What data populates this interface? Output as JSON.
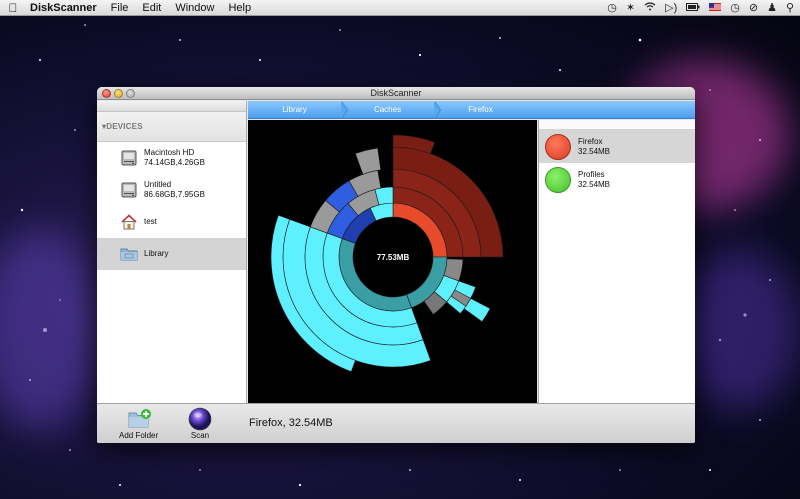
{
  "menubar": {
    "apple_icon": "apple-icon",
    "app_name": "DiskScanner",
    "items": [
      "File",
      "Edit",
      "Window",
      "Help"
    ],
    "status_icons": [
      "time-machine-icon",
      "bluetooth-icon",
      "wifi-icon",
      "volume-icon",
      "battery-icon",
      "flag-icon",
      "clock-icon",
      "no-entry-icon",
      "user-icon",
      "spotlight-icon"
    ]
  },
  "window": {
    "title": "DiskScanner"
  },
  "sidebar": {
    "header": "▾DEVICES",
    "items": [
      {
        "name": "Macintosh HD",
        "detail": "74.14GB,4.26GB",
        "icon": "hard-drive-icon",
        "selected": false
      },
      {
        "name": "Untitled",
        "detail": "86.68GB,7.95GB",
        "icon": "hard-drive-icon",
        "selected": false
      },
      {
        "name": "test",
        "detail": "",
        "icon": "home-icon",
        "selected": false
      },
      {
        "name": "Library",
        "detail": "",
        "icon": "folder-icon",
        "selected": true
      }
    ]
  },
  "breadcrumb": [
    "Library",
    "Caches",
    "Firefox"
  ],
  "chart_data": {
    "type": "sunburst",
    "center_label": "77.53MB",
    "segments": [
      {
        "name": "Firefox",
        "size": "32.54MB",
        "color": "#e74c2c"
      },
      {
        "name": "Profiles",
        "size": "32.54MB",
        "color": "#5bd13c"
      }
    ],
    "colors": {
      "firefox": "#8b2418",
      "cyan": "#5ef0ff",
      "teal": "#3a9ea5",
      "blue": "#2f5ee0",
      "gray": "#9a9a9a"
    }
  },
  "list": [
    {
      "name": "Firefox",
      "size": "32.54MB",
      "color": "#e74c2c",
      "selected": true
    },
    {
      "name": "Profiles",
      "size": "32.54MB",
      "color": "#5bd13c",
      "selected": false
    }
  ],
  "toolbar": {
    "add_folder_label": "Add Folder",
    "scan_label": "Scan"
  },
  "status": "Firefox, 32.54MB"
}
